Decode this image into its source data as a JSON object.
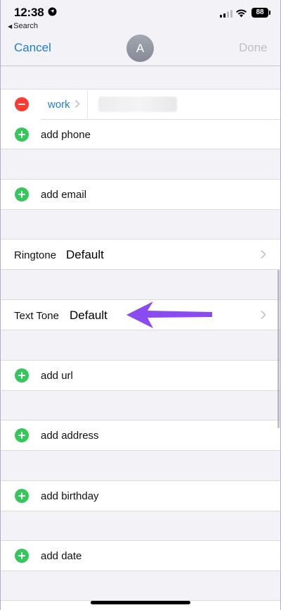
{
  "status_bar": {
    "time": "12:38",
    "back_label": "Search",
    "battery": "88"
  },
  "nav": {
    "cancel": "Cancel",
    "avatar_initial": "A",
    "done": "Done"
  },
  "phone": {
    "label": "work",
    "add_phone": "add phone"
  },
  "email": {
    "label": "add email"
  },
  "ringtone": {
    "label": "Ringtone",
    "value": "Default"
  },
  "text_tone": {
    "label": "Text Tone",
    "value": "Default"
  },
  "url": {
    "label": "add url"
  },
  "address": {
    "label": "add address"
  },
  "birthday": {
    "label": "add birthday"
  },
  "date": {
    "label": "add date"
  },
  "colors": {
    "accent": "#1f7fc8",
    "add": "#34c759",
    "delete": "#ff3b30",
    "annotation_arrow": "#8a4cf0"
  }
}
